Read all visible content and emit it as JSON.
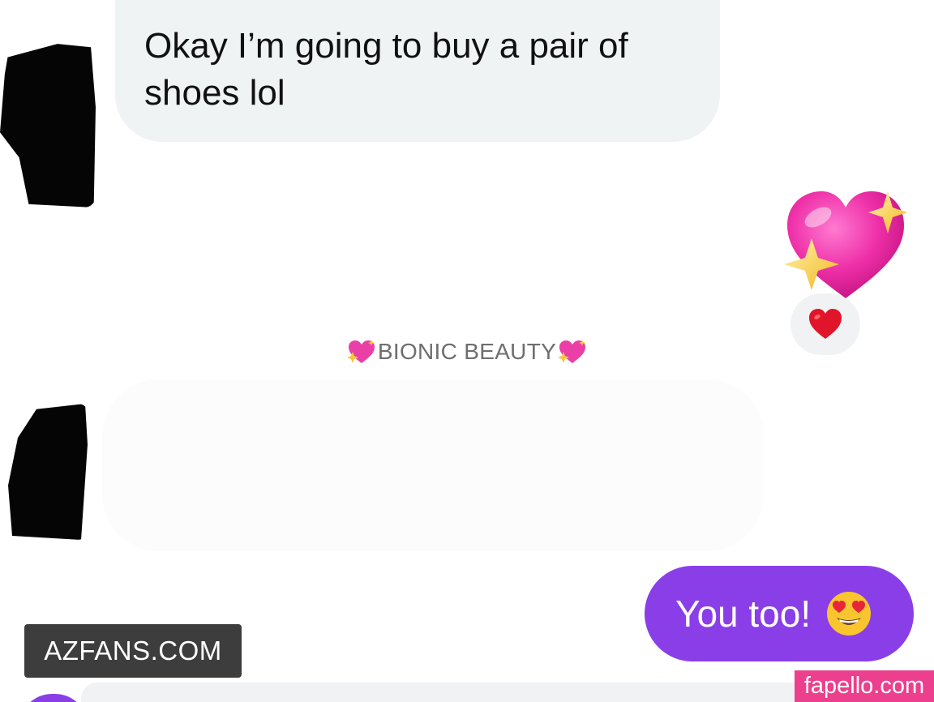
{
  "conversation": {
    "incoming_message_1": "Okay I’m going to buy a pair of shoes lol",
    "incoming_message_2": "",
    "outgoing_message": "You too!",
    "outgoing_emoji": "smiling-face-with-heart-eyes",
    "sticker": "sparkling-heart",
    "reaction": "red-heart"
  },
  "divider": {
    "label": "BIONIC BEAUTY",
    "emoji": "sparkling-heart"
  },
  "watermarks": {
    "left": "AZFANS.COM",
    "right": "fapello.com"
  },
  "colors": {
    "outgoing_bubble": "#8a3ee8",
    "incoming_bubble": "#eff3f3",
    "watermark_right_bg": "#ec3f8d",
    "watermark_left_bg": "#3d3d3d"
  }
}
